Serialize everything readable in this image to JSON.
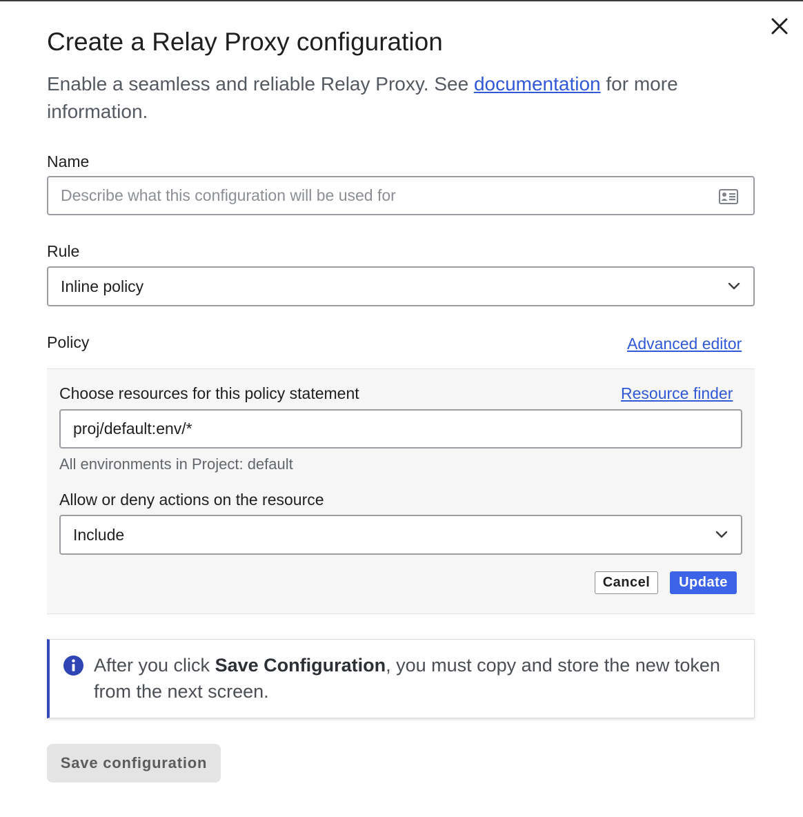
{
  "dialog": {
    "title": "Create a Relay Proxy configuration",
    "subtitle_before": "Enable a seamless and reliable Relay Proxy. See ",
    "subtitle_link": "documentation",
    "subtitle_after": " for more information."
  },
  "name_field": {
    "label": "Name",
    "value": "",
    "placeholder": "Describe what this configuration will be used for",
    "icon": "contact-card-icon"
  },
  "rule_field": {
    "label": "Rule",
    "selected": "Inline policy",
    "icon": "chevron-down-icon"
  },
  "policy": {
    "label": "Policy",
    "advanced_editor_link": "Advanced editor",
    "resources_label": "Choose resources for this policy statement",
    "resource_finder_link": "Resource finder",
    "resource_value": "proj/default:env/*",
    "resource_hint_a": "All environments",
    "resource_hint_b": "in Project: default",
    "actions_label": "Allow or deny actions on the resource",
    "actions_selected": "Include",
    "cancel_label": "Cancel",
    "update_label": "Update"
  },
  "callout": {
    "icon": "info-icon",
    "text_before": "After you click ",
    "text_bold": "Save Configuration",
    "text_after": ", you must copy and store the new token from the next screen."
  },
  "footer": {
    "save_label": "Save configuration"
  },
  "colors": {
    "accent": "#3d63e8",
    "link": "#3158d6",
    "callout_border": "#3347b8"
  }
}
